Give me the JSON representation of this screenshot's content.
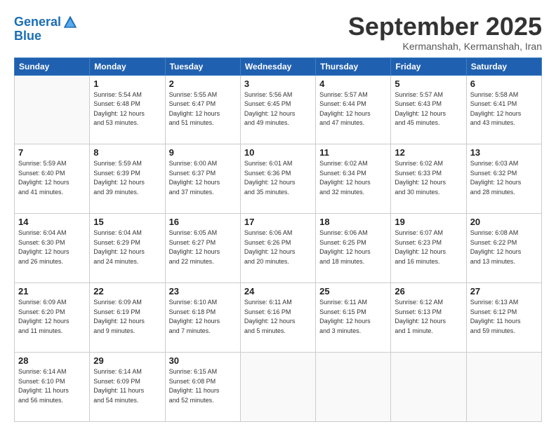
{
  "header": {
    "logo_line1": "General",
    "logo_line2": "Blue",
    "month_title": "September 2025",
    "subtitle": "Kermanshah, Kermanshah, Iran"
  },
  "weekdays": [
    "Sunday",
    "Monday",
    "Tuesday",
    "Wednesday",
    "Thursday",
    "Friday",
    "Saturday"
  ],
  "weeks": [
    [
      {
        "day": "",
        "info": ""
      },
      {
        "day": "1",
        "info": "Sunrise: 5:54 AM\nSunset: 6:48 PM\nDaylight: 12 hours\nand 53 minutes."
      },
      {
        "day": "2",
        "info": "Sunrise: 5:55 AM\nSunset: 6:47 PM\nDaylight: 12 hours\nand 51 minutes."
      },
      {
        "day": "3",
        "info": "Sunrise: 5:56 AM\nSunset: 6:45 PM\nDaylight: 12 hours\nand 49 minutes."
      },
      {
        "day": "4",
        "info": "Sunrise: 5:57 AM\nSunset: 6:44 PM\nDaylight: 12 hours\nand 47 minutes."
      },
      {
        "day": "5",
        "info": "Sunrise: 5:57 AM\nSunset: 6:43 PM\nDaylight: 12 hours\nand 45 minutes."
      },
      {
        "day": "6",
        "info": "Sunrise: 5:58 AM\nSunset: 6:41 PM\nDaylight: 12 hours\nand 43 minutes."
      }
    ],
    [
      {
        "day": "7",
        "info": "Sunrise: 5:59 AM\nSunset: 6:40 PM\nDaylight: 12 hours\nand 41 minutes."
      },
      {
        "day": "8",
        "info": "Sunrise: 5:59 AM\nSunset: 6:39 PM\nDaylight: 12 hours\nand 39 minutes."
      },
      {
        "day": "9",
        "info": "Sunrise: 6:00 AM\nSunset: 6:37 PM\nDaylight: 12 hours\nand 37 minutes."
      },
      {
        "day": "10",
        "info": "Sunrise: 6:01 AM\nSunset: 6:36 PM\nDaylight: 12 hours\nand 35 minutes."
      },
      {
        "day": "11",
        "info": "Sunrise: 6:02 AM\nSunset: 6:34 PM\nDaylight: 12 hours\nand 32 minutes."
      },
      {
        "day": "12",
        "info": "Sunrise: 6:02 AM\nSunset: 6:33 PM\nDaylight: 12 hours\nand 30 minutes."
      },
      {
        "day": "13",
        "info": "Sunrise: 6:03 AM\nSunset: 6:32 PM\nDaylight: 12 hours\nand 28 minutes."
      }
    ],
    [
      {
        "day": "14",
        "info": "Sunrise: 6:04 AM\nSunset: 6:30 PM\nDaylight: 12 hours\nand 26 minutes."
      },
      {
        "day": "15",
        "info": "Sunrise: 6:04 AM\nSunset: 6:29 PM\nDaylight: 12 hours\nand 24 minutes."
      },
      {
        "day": "16",
        "info": "Sunrise: 6:05 AM\nSunset: 6:27 PM\nDaylight: 12 hours\nand 22 minutes."
      },
      {
        "day": "17",
        "info": "Sunrise: 6:06 AM\nSunset: 6:26 PM\nDaylight: 12 hours\nand 20 minutes."
      },
      {
        "day": "18",
        "info": "Sunrise: 6:06 AM\nSunset: 6:25 PM\nDaylight: 12 hours\nand 18 minutes."
      },
      {
        "day": "19",
        "info": "Sunrise: 6:07 AM\nSunset: 6:23 PM\nDaylight: 12 hours\nand 16 minutes."
      },
      {
        "day": "20",
        "info": "Sunrise: 6:08 AM\nSunset: 6:22 PM\nDaylight: 12 hours\nand 13 minutes."
      }
    ],
    [
      {
        "day": "21",
        "info": "Sunrise: 6:09 AM\nSunset: 6:20 PM\nDaylight: 12 hours\nand 11 minutes."
      },
      {
        "day": "22",
        "info": "Sunrise: 6:09 AM\nSunset: 6:19 PM\nDaylight: 12 hours\nand 9 minutes."
      },
      {
        "day": "23",
        "info": "Sunrise: 6:10 AM\nSunset: 6:18 PM\nDaylight: 12 hours\nand 7 minutes."
      },
      {
        "day": "24",
        "info": "Sunrise: 6:11 AM\nSunset: 6:16 PM\nDaylight: 12 hours\nand 5 minutes."
      },
      {
        "day": "25",
        "info": "Sunrise: 6:11 AM\nSunset: 6:15 PM\nDaylight: 12 hours\nand 3 minutes."
      },
      {
        "day": "26",
        "info": "Sunrise: 6:12 AM\nSunset: 6:13 PM\nDaylight: 12 hours\nand 1 minute."
      },
      {
        "day": "27",
        "info": "Sunrise: 6:13 AM\nSunset: 6:12 PM\nDaylight: 11 hours\nand 59 minutes."
      }
    ],
    [
      {
        "day": "28",
        "info": "Sunrise: 6:14 AM\nSunset: 6:10 PM\nDaylight: 11 hours\nand 56 minutes."
      },
      {
        "day": "29",
        "info": "Sunrise: 6:14 AM\nSunset: 6:09 PM\nDaylight: 11 hours\nand 54 minutes."
      },
      {
        "day": "30",
        "info": "Sunrise: 6:15 AM\nSunset: 6:08 PM\nDaylight: 11 hours\nand 52 minutes."
      },
      {
        "day": "",
        "info": ""
      },
      {
        "day": "",
        "info": ""
      },
      {
        "day": "",
        "info": ""
      },
      {
        "day": "",
        "info": ""
      }
    ]
  ]
}
